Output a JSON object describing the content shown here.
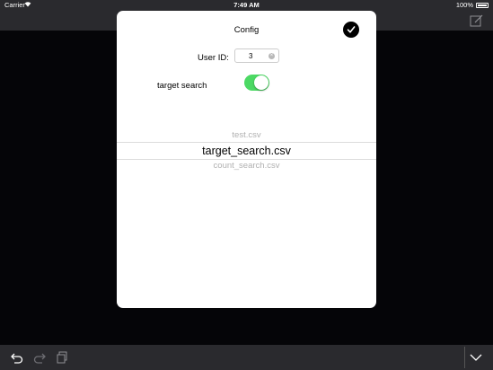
{
  "status_bar": {
    "carrier": "Carrier",
    "time": "7:49 AM",
    "battery": "100%"
  },
  "modal": {
    "title": "Config",
    "user_id_label": "User ID:",
    "user_id_value": "3",
    "target_search_label": "target search",
    "target_search_on": true,
    "toggle_color": "#4cd964",
    "picker_options": [
      "test.csv",
      "target_search.csv",
      "count_search.csv"
    ],
    "picker_selected": "target_search.csv"
  },
  "toolbar": {
    "icons": [
      "undo-icon",
      "redo-icon",
      "copy-icon",
      "chevron-down-icon"
    ]
  },
  "nav_bar": {
    "icons": [
      "compose-icon"
    ]
  }
}
